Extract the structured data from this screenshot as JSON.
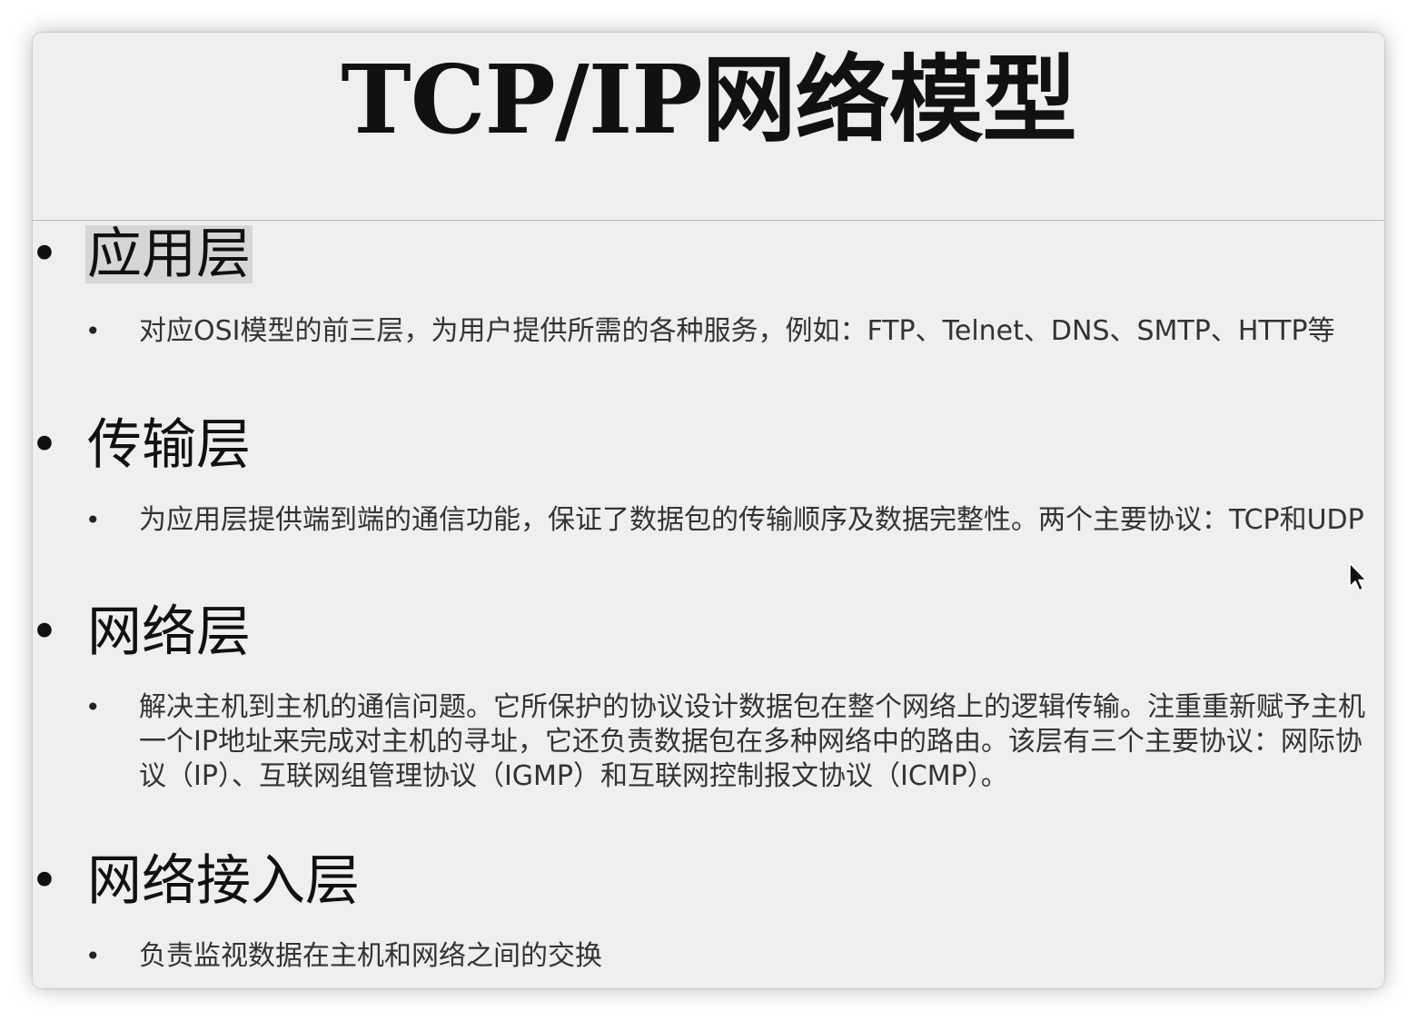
{
  "slide": {
    "title": "TCP/IP网络模型",
    "sections": [
      {
        "heading": "应用层",
        "body": "对应OSI模型的前三层，为用户提供所需的各种服务，例如：FTP、Telnet、DNS、SMTP、HTTP等"
      },
      {
        "heading": "传输层",
        "body": "为应用层提供端到端的通信功能，保证了数据包的传输顺序及数据完整性。两个主要协议：TCP和UDP"
      },
      {
        "heading": "网络层",
        "body": "解决主机到主机的通信问题。它所保护的协议设计数据包在整个网络上的逻辑传输。注重重新赋予主机一个IP地址来完成对主机的寻址，它还负责数据包在多种网络中的路由。该层有三个主要协议：网际协议（IP）、互联网组管理协议（IGMP）和互联网控制报文协议（ICMP）。"
      },
      {
        "heading": "网络接入层",
        "body": "负责监视数据在主机和网络之间的交换"
      }
    ]
  },
  "icons": {
    "bullet": "•",
    "cursor": "mouse-pointer-icon"
  },
  "colors": {
    "slide_background": "#efefef",
    "text": "#111111",
    "body_text": "#333333",
    "selection_highlight": "#d6d6d6"
  }
}
